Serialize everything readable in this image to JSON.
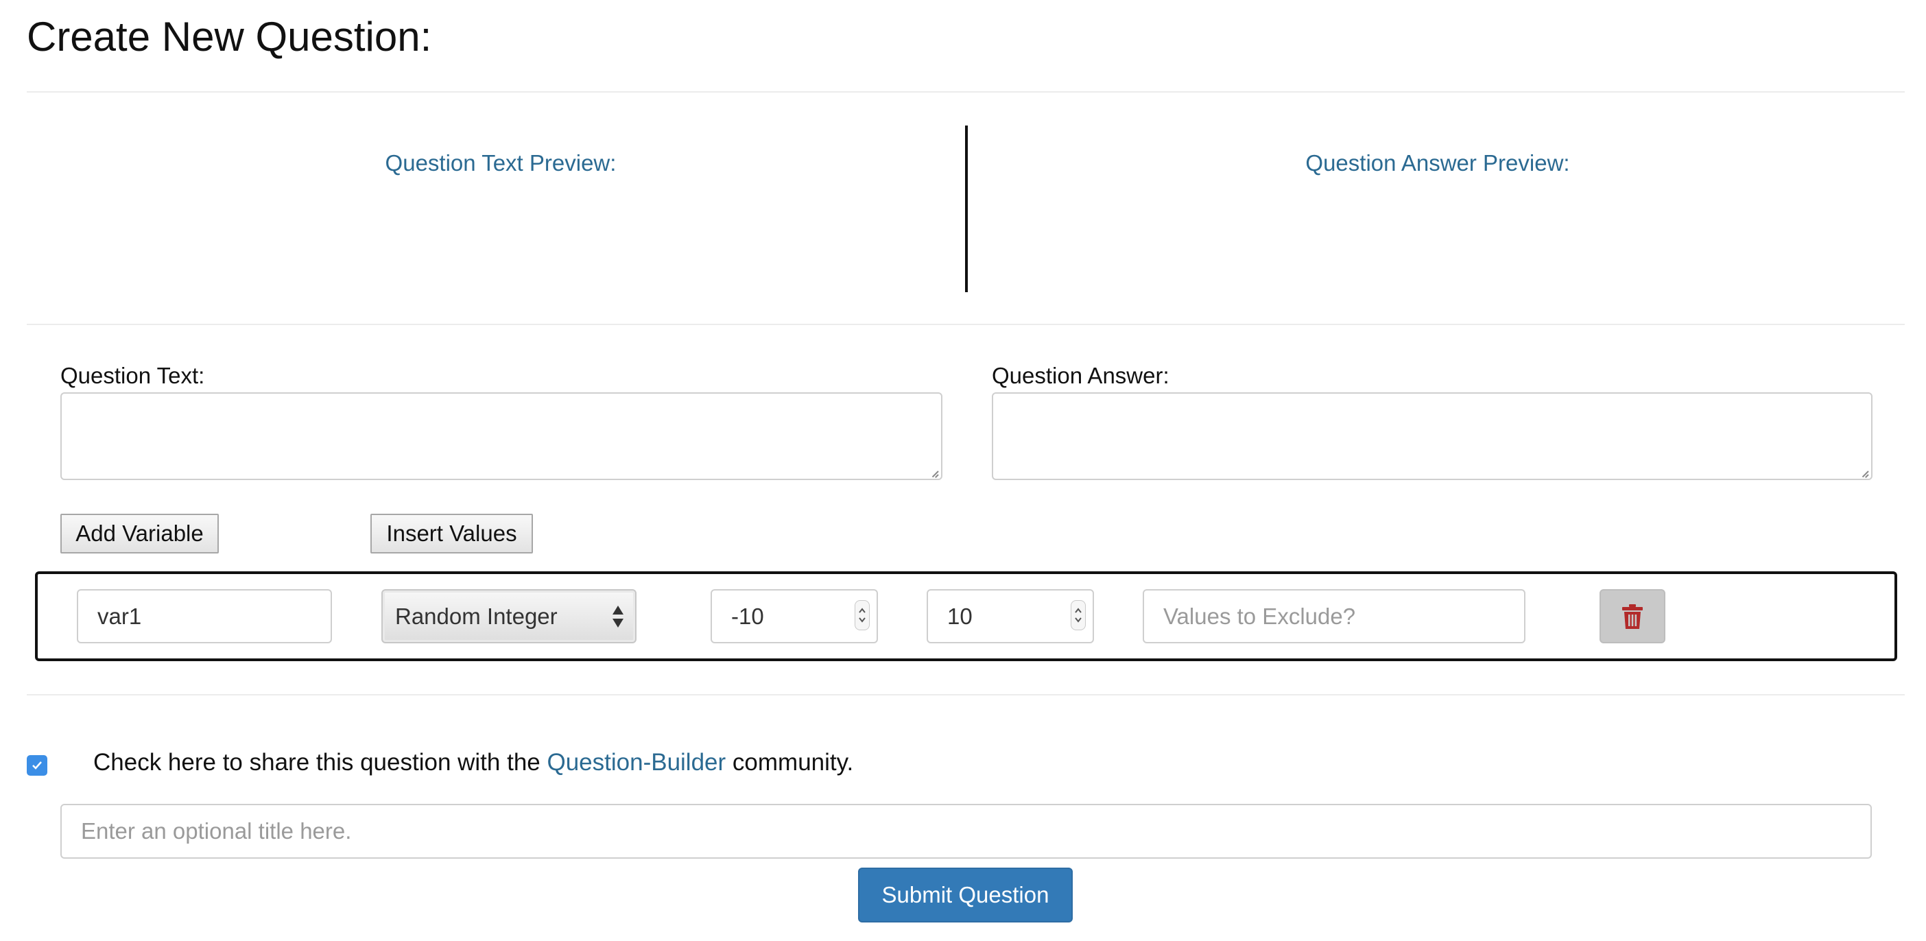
{
  "page": {
    "title": "Create New Question:"
  },
  "preview": {
    "text_label": "Question Text Preview:",
    "answer_label": "Question Answer Preview:"
  },
  "editor": {
    "question_text_label": "Question Text:",
    "question_answer_label": "Question Answer:",
    "question_text_value": "",
    "question_answer_value": ""
  },
  "buttons": {
    "add_variable": "Add Variable",
    "insert_values": "Insert Values",
    "submit": "Submit Question"
  },
  "variable_row": {
    "name_value": "var1",
    "type_selected": "Random Integer",
    "min_value": "-10",
    "max_value": "10",
    "exclude_placeholder": "Values to Exclude?",
    "delete_icon": "trash-icon"
  },
  "share": {
    "checked": true,
    "text_before": "Check here to share this question with the ",
    "link_text": "Question-Builder",
    "text_after": " community."
  },
  "title_input": {
    "placeholder": "Enter an optional title here."
  },
  "colors": {
    "accent_link": "#2b6a92",
    "primary_button": "#337ab7",
    "checkbox": "#3b8ee6",
    "delete_icon": "#b22a2a"
  }
}
